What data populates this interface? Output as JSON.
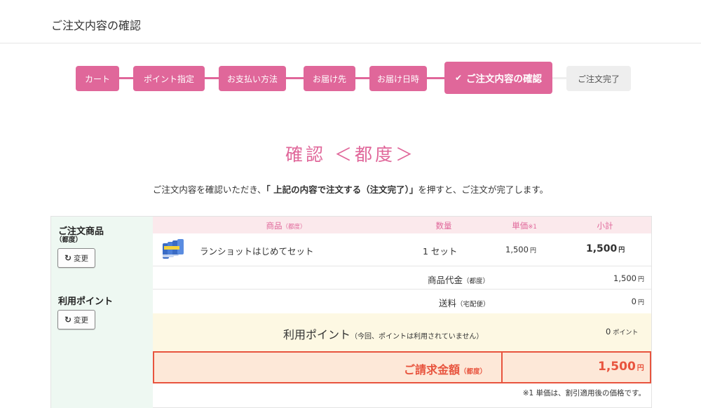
{
  "header": {
    "title": "ご注文内容の確認"
  },
  "steps": [
    {
      "label": "カート",
      "state": "done"
    },
    {
      "label": "ポイント指定",
      "state": "done"
    },
    {
      "label": "お支払い方法",
      "state": "done"
    },
    {
      "label": "お届け先",
      "state": "done"
    },
    {
      "label": "お届け日時",
      "state": "done"
    },
    {
      "label": "ご注文内容の確認",
      "state": "current",
      "icon": "check-icon"
    },
    {
      "label": "ご注文完了",
      "state": "pending"
    }
  ],
  "heading": "確認 ＜都度＞",
  "instruction": {
    "prefix": "ご注文内容を確認いただき、",
    "emphasis": "「 上記の内容で注文する（注文完了）」",
    "suffix": "を押すと、ご注文が完了します。"
  },
  "sidebar": {
    "order_label": "ご注文商品",
    "order_sub": "（都度）",
    "change_label": "変更",
    "points_label": "利用ポイント",
    "change_label_2": "変更"
  },
  "table": {
    "headers": {
      "product": "商品",
      "product_sub": "（都度）",
      "qty": "数量",
      "unit_price": "単価",
      "unit_price_note": "※1",
      "subtotal": "小計"
    },
    "item": {
      "name": "ランショットはじめてセット",
      "qty": "1 セット",
      "unit_price": "1,500",
      "subtotal": "1,500",
      "currency": "円"
    },
    "product_total_label": "商品代金",
    "product_total_sub": "（都度）",
    "product_total_value": "1,500",
    "shipping_label": "送料",
    "shipping_sub": "（宅配便）",
    "shipping_value": "0",
    "currency": "円"
  },
  "points": {
    "label": "利用ポイント",
    "note": "（今回、ポイントは利用されていません）",
    "value": "0",
    "unit": "ポイント"
  },
  "total": {
    "label": "ご請求金額",
    "sub": "（都度）",
    "value": "1,500",
    "currency": "円"
  },
  "footnote": "※1 単価は、割引適用後の価格です。",
  "colors": {
    "accent": "#e0679a",
    "total_border": "#e8543e",
    "total_bg": "#fde8d8"
  }
}
